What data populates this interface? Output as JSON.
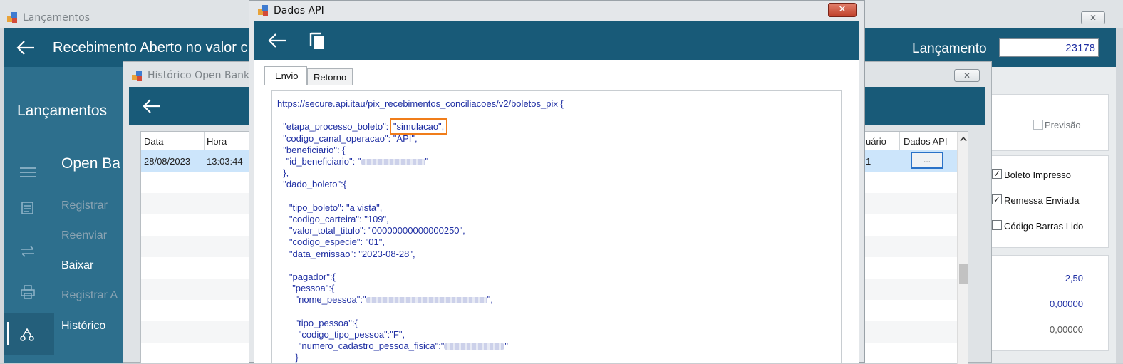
{
  "main_window": {
    "title": "Lançamentos",
    "header_title": "Recebimento Aberto no valor c",
    "lancamento_label": "Lançamento",
    "lancamento_value": "23178",
    "sidebar": {
      "title": "Lançamentos",
      "section": "Open Ba",
      "items": [
        {
          "label": "Registrar",
          "icon": "document-icon"
        },
        {
          "label": "Reenviar",
          "icon": "swap-icon"
        },
        {
          "label": "Baixar",
          "icon": "swap-icon"
        },
        {
          "label": "Registrar A",
          "icon": "printer-icon"
        },
        {
          "label": "Histórico",
          "icon": "history-icon"
        }
      ]
    },
    "right_panel": {
      "previsao": "Previsão",
      "boleto_impresso": "Boleto Impresso",
      "remessa_enviada": "Remessa Enviada",
      "codigo_barras_lido": "Código Barras Lido",
      "values": [
        "2,50",
        "0,00000",
        "0,00000"
      ]
    },
    "close_glyph": "✕"
  },
  "historico_window": {
    "title": "Histórico Open Banki",
    "columns": [
      "Data",
      "Hora",
      "uário",
      "Dados API"
    ],
    "row": {
      "data": "28/08/2023",
      "hora": "13:03:44",
      "usuario": "1",
      "dados_api_button": "..."
    },
    "close_glyph": "✕"
  },
  "api_window": {
    "title": "Dados API",
    "close_glyph": "✕",
    "tabs": [
      "Envio",
      "Retorno"
    ],
    "active_tab": "Envio",
    "code_lines": [
      {
        "text": "https://secure.api.itau/pix_recebimentos_conciliacoes/v2/boletos_pix {",
        "indent": 0
      },
      {
        "text": "",
        "indent": 0
      },
      {
        "text": "\"etapa_processo_boleto\": ",
        "highlight": "\"simulacao\",",
        "indent": 1
      },
      {
        "text": "\"codigo_canal_operacao\": \"API\",",
        "indent": 1
      },
      {
        "text": "\"beneficiario\": {",
        "indent": 1
      },
      {
        "text": "\"id_beneficiario\": \"",
        "blur": 90,
        "after": "\"",
        "indent": 2
      },
      {
        "text": "},",
        "indent": 1
      },
      {
        "text": "\"dado_boleto\":{",
        "indent": 1
      },
      {
        "text": "",
        "indent": 0
      },
      {
        "text": "\"tipo_boleto\": \"a vista\",",
        "indent": 3
      },
      {
        "text": "\"codigo_carteira\": \"109\",",
        "indent": 3
      },
      {
        "text": "\"valor_total_titulo\": \"00000000000000250\",",
        "indent": 3
      },
      {
        "text": "\"codigo_especie\": \"01\",",
        "indent": 3
      },
      {
        "text": "\"data_emissao\": \"2023-08-28\",",
        "indent": 3
      },
      {
        "text": "",
        "indent": 0
      },
      {
        "text": "\"pagador\":{",
        "indent": 3
      },
      {
        "text": "\"pessoa\":{",
        "indent": 4
      },
      {
        "text": "\"nome_pessoa\":\"",
        "blur": 170,
        "after": "\",",
        "indent": 5
      },
      {
        "text": "",
        "indent": 0
      },
      {
        "text": "\"tipo_pessoa\":{",
        "indent": 5
      },
      {
        "text": "\"codigo_tipo_pessoa\":\"F\",",
        "indent": 6
      },
      {
        "text": "\"numero_cadastro_pessoa_fisica\":\"",
        "blur": 85,
        "after": "\"",
        "indent": 6
      },
      {
        "text": "}",
        "indent": 5
      }
    ],
    "highlight_color": "#f07d1a"
  }
}
